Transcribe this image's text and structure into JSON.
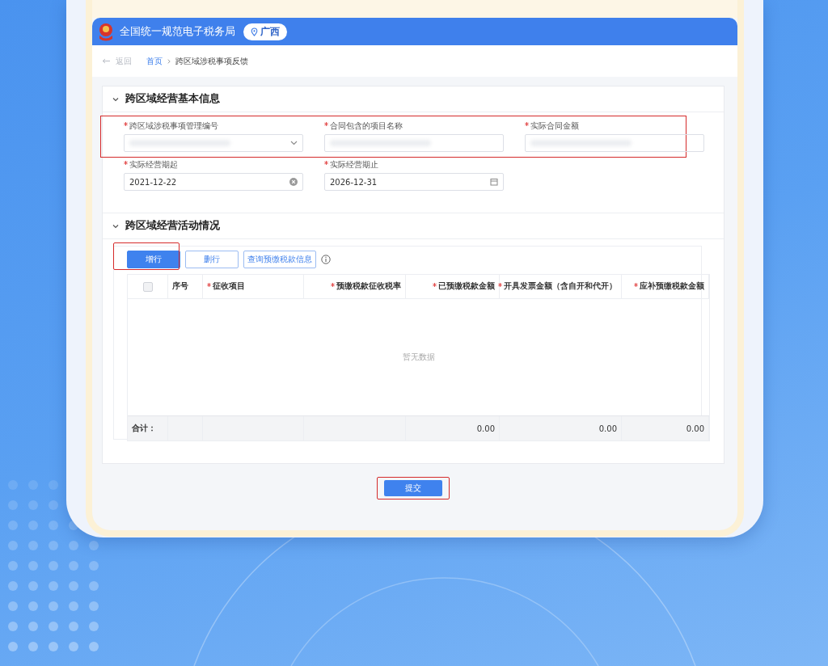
{
  "header": {
    "title": "全国统一规范电子税务局",
    "region": "广西"
  },
  "breadcrumb": {
    "back": "返回",
    "items": [
      "首页",
      "跨区域涉税事项反馈"
    ]
  },
  "basic_info": {
    "title": "跨区域经营基本信息",
    "expanded": true,
    "rows": [
      {
        "highlighted": true,
        "fields": [
          {
            "label": "跨区域涉税事项管理编号",
            "required": true,
            "kind": "select",
            "redacted": true
          },
          {
            "label": "合同包含的项目名称",
            "required": true,
            "kind": "text",
            "redacted": true
          },
          {
            "label": "实际合同金额",
            "required": true,
            "kind": "text",
            "redacted": true
          }
        ]
      },
      {
        "highlighted": false,
        "fields": [
          {
            "label": "实际经营期起",
            "required": true,
            "kind": "date-clear",
            "value": "2021-12-22"
          },
          {
            "label": "实际经营期止",
            "required": true,
            "kind": "date",
            "value": "2026-12-31"
          }
        ]
      }
    ]
  },
  "activities": {
    "title": "跨区域经营活动情况",
    "expanded": true,
    "buttons": [
      {
        "label": "增行",
        "kind": "primary",
        "highlighted": true
      },
      {
        "label": "删行",
        "kind": "outline",
        "highlighted": false
      },
      {
        "label": "查询预缴税款信息",
        "kind": "outline",
        "highlighted": false
      }
    ],
    "table": {
      "columns": [
        {
          "kind": "checkbox",
          "checked": false
        },
        {
          "label": "序号",
          "required": false
        },
        {
          "label": "征收项目",
          "required": true
        },
        {
          "label": "预缴税款征收税率",
          "required": true
        },
        {
          "label": "已预缴税款金额",
          "required": true
        },
        {
          "label": "开具发票金额（含自开和代开）",
          "required": true
        },
        {
          "label": "应补预缴税款金额",
          "required": true
        }
      ],
      "empty_text": "暂无数据",
      "footer": {
        "label": "合计：",
        "totals": [
          "0.00",
          "0.00",
          "0.00"
        ]
      }
    }
  },
  "submit": {
    "label": "提交",
    "highlighted": true
  }
}
